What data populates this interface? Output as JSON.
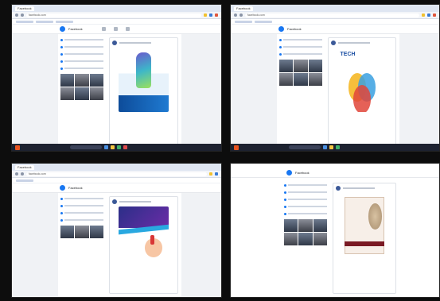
{
  "collage": {
    "panes": [
      {
        "id": "p1",
        "tab": "Facebook",
        "url": "facebook.com",
        "page_name": "Facebook"
      },
      {
        "id": "p2",
        "tab": "Facebook",
        "url": "facebook.com",
        "page_name": "Facebook",
        "graphic_text": "TECH"
      },
      {
        "id": "p3",
        "tab": "Facebook",
        "url": "facebook.com",
        "page_name": "Facebook"
      },
      {
        "id": "p4",
        "tab": "",
        "url": "",
        "page_name": "Facebook"
      }
    ]
  },
  "colors": {
    "facebook_blue": "#1877f2",
    "taskbar": "#1d2230"
  },
  "icons": [
    "facebook-icon",
    "start-icon",
    "search-icon"
  ]
}
